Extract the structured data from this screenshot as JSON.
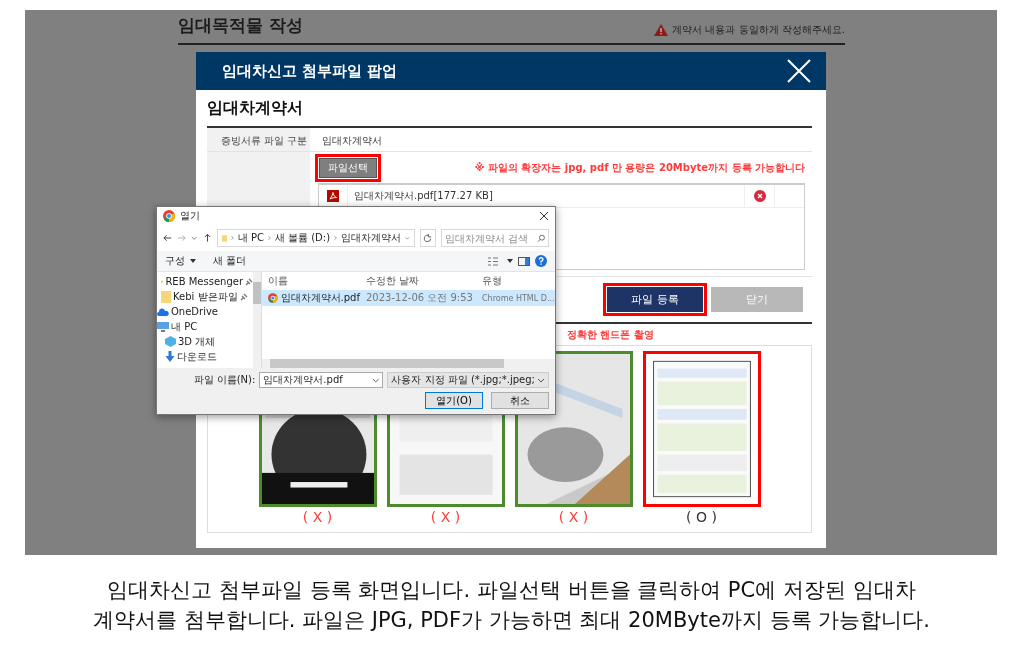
{
  "background_page": {
    "title": "임대목적물 작성",
    "warning": "계약서 내용과 동일하게 작성해주세요."
  },
  "popup": {
    "title": "임대차신고 첨부파일 팝업",
    "section_title": "임대차계약서",
    "file_type_label": "증빙서류 파일 구분",
    "file_type_value": "임대차계약서",
    "select_button": {
      "label": "파일선택",
      "highlighted": true
    },
    "notice": "※ 파일의 확장자는 jpg, pdf 만 용량은 20Mbyte까지 등록 가능합니다",
    "files": [
      {
        "name": "임대차계약서.pdf[177.27 KB]"
      }
    ],
    "buttons": [
      {
        "label": "파일 등록",
        "kind": "primary",
        "highlighted": true
      },
      {
        "label": "닫기",
        "kind": "secondary",
        "highlighted": false
      }
    ],
    "guide_text": "정확한 핸드폰 촬영",
    "examples": [
      {
        "mark": "( X )",
        "ok": false
      },
      {
        "mark": "( X )",
        "ok": false
      },
      {
        "mark": "( X )",
        "ok": false
      },
      {
        "mark": "( O )",
        "ok": true
      }
    ]
  },
  "file_dialog": {
    "title": "열기",
    "path": [
      "내 PC",
      "새 볼륨 (D:)",
      "임대차계약서"
    ],
    "search": {
      "placeholder": "임대차계약서 검색"
    },
    "toolbar": [
      "구성",
      "새 폴더"
    ],
    "nav": [
      {
        "label": "REB Messenger",
        "kind": "folder",
        "pinned": true
      },
      {
        "label": "Kebi 받은파일",
        "kind": "folder",
        "pinned": true
      },
      {
        "label": "OneDrive",
        "kind": "cloud",
        "pinned": false
      },
      {
        "label": "내 PC",
        "kind": "pc",
        "pinned": false
      },
      {
        "label": "3D 개체",
        "kind": "cube",
        "pinned": false
      },
      {
        "label": "다운로드",
        "kind": "download",
        "pinned": false
      }
    ],
    "columns": [
      "이름",
      "수정한 날짜",
      "유형"
    ],
    "files": [
      {
        "name": "임대차계약서.pdf",
        "date": "2023-12-06 오전 9:53",
        "type": "Chrome HTML D...",
        "selected": true
      }
    ],
    "filename_label": "파일 이름(N):",
    "filename": "임대차계약서.pdf",
    "filter": "사용자 지정 파일 (*.jpg;*.jpeg;",
    "buttons": [
      {
        "label": "열기(O)",
        "kind": "default"
      },
      {
        "label": "취소",
        "kind": "normal"
      }
    ]
  },
  "caption": [
    "임대차신고 첨부파일 등록 화면입니다. 파일선택 버튼을 클릭하여 PC에 저장된 임대차",
    "계약서를 첨부합니다. 파일은 JPG, PDF가 가능하면 최대 20MByte까지 등록 가능합니다."
  ]
}
